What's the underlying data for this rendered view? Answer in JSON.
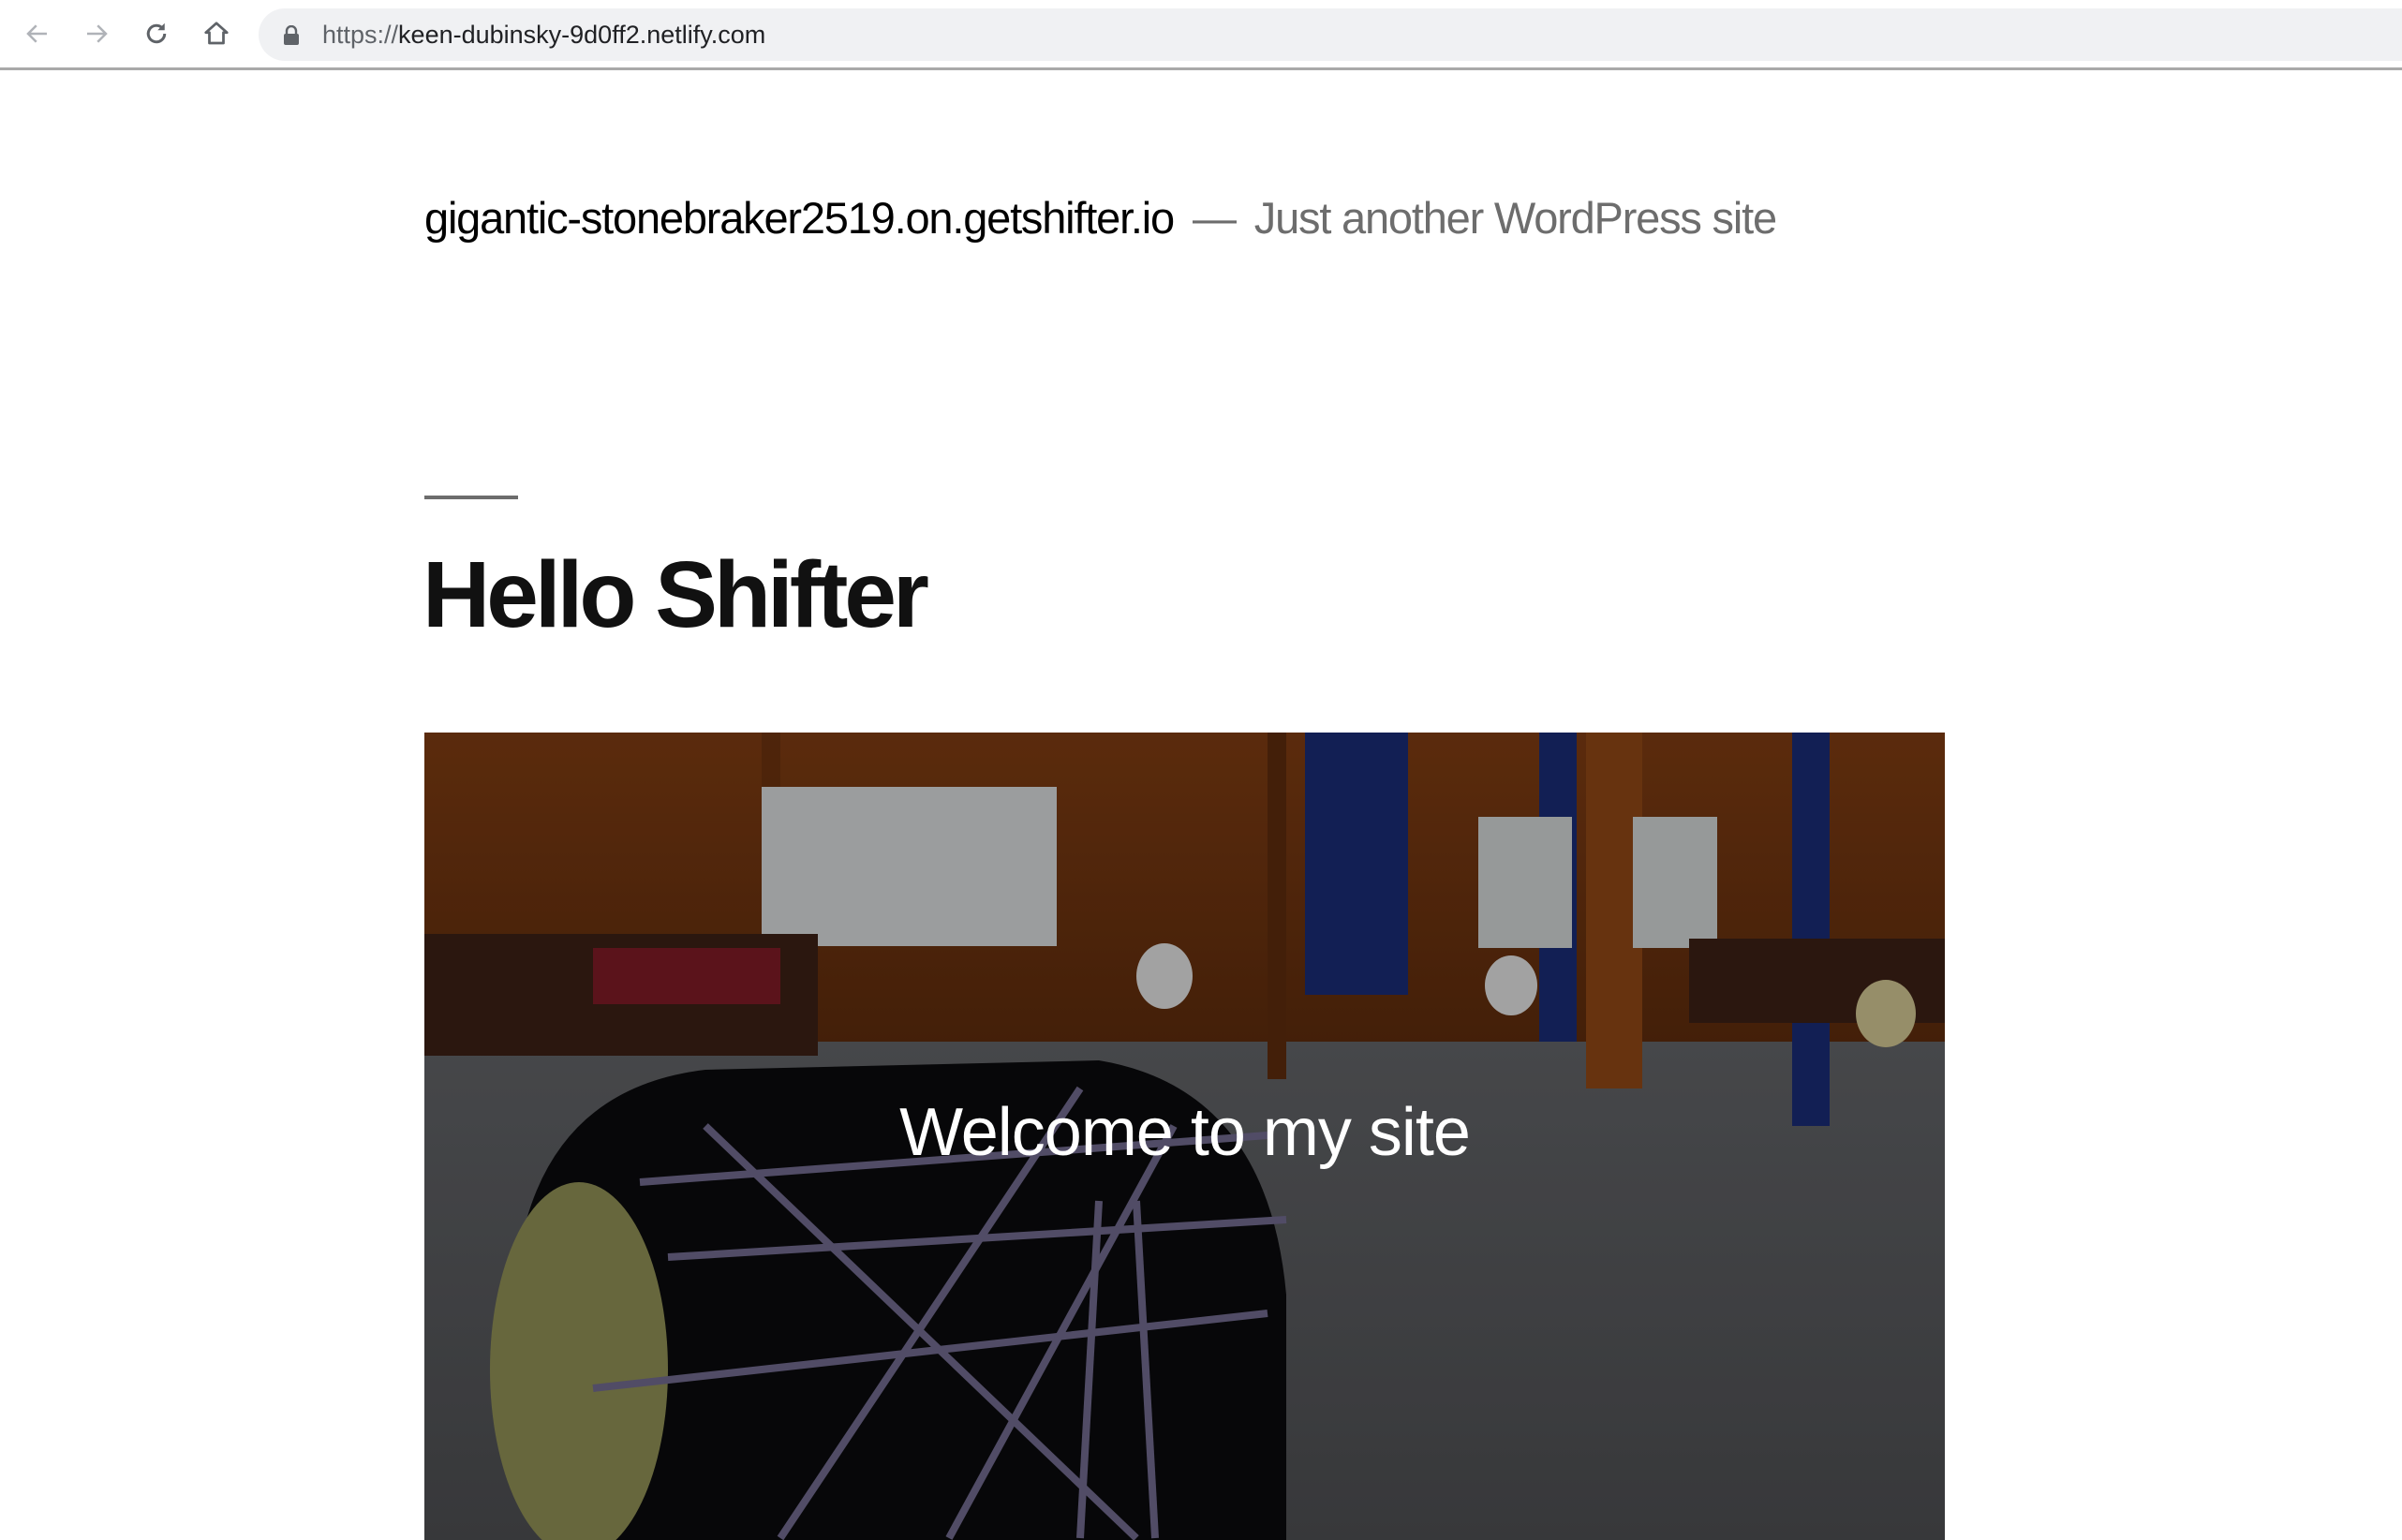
{
  "browser": {
    "url_scheme": "https://",
    "url_host": "keen-dubinsky-9d0ff2.netlify.com",
    "icons": [
      "back-icon",
      "forward-icon",
      "reload-icon",
      "home-icon",
      "lock-icon"
    ]
  },
  "site": {
    "title": "gigantic-stonebraker2519.on.getshifter.io",
    "separator": "—",
    "tagline": "Just another WordPress site"
  },
  "post": {
    "title": "Hello Shifter",
    "cover_text": "Welcome to my site"
  },
  "colors": {
    "text": "#000000",
    "muted": "#6d6d6d",
    "omnibox": "#f0f1f3"
  }
}
